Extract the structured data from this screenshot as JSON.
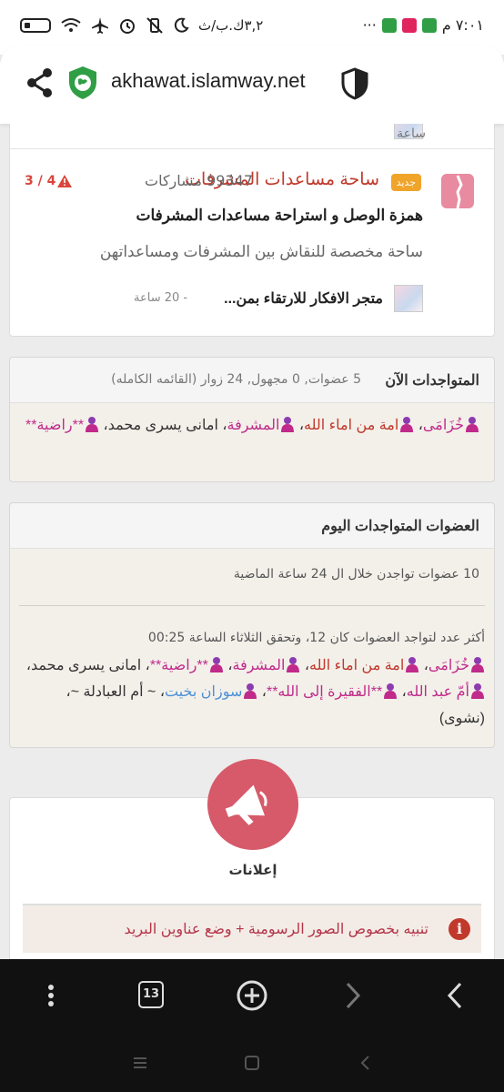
{
  "status_bar": {
    "time": "٧:٠١ م",
    "network_text": "٣,٢ك.ب/ث",
    "overflow": "···"
  },
  "browser": {
    "url": "akhawat.islamway.net",
    "tabs_count": "13"
  },
  "forum": {
    "previous_row_text": "ساعة",
    "new_badge": "جديد",
    "title": "ساحة مساعدات المشرفات",
    "posts": "99347 مشاركات",
    "warn_count": "3 / 4",
    "subtitle": "همزة الوصل و استراحة مساعدات المشرفات",
    "description": "ساحة مخصصة للنقاش بين المشرفات ومساعداتهن",
    "last_post_title": "متجر الافكار للارتقاء بمن...",
    "last_post_time": "- 20 ساعة"
  },
  "online_now": {
    "title": "المتواجدات الآن",
    "meta": "5 عضوات, 0 مجهول, 24 زوار (القائمه الكامله)",
    "users": [
      {
        "name": "خُزَامَى",
        "color": "#c02a8a"
      },
      {
        "name": "امة من اماء الله",
        "color": "#c0392b"
      },
      {
        "name": "المشرفة",
        "color": "#c02a8a"
      },
      {
        "name": "امانى يسرى محمد",
        "color": "#333333"
      },
      {
        "name": "**راضية**",
        "color": "#c02a8a"
      }
    ]
  },
  "today": {
    "title": "العضوات المتواجدات اليوم",
    "count_line": "10 عضوات تواجدن خلال ال 24 ساعة الماضية",
    "record_line": "أكثر عدد لتواجد العضوات كان 12، وتحقق الثلاثاء الساعة 00:25",
    "users": [
      {
        "name": "خُزَامَى",
        "color": "#c02a8a"
      },
      {
        "name": "امة من اماء الله",
        "color": "#c0392b"
      },
      {
        "name": "المشرفة",
        "color": "#c02a8a"
      },
      {
        "name": "**راضية**",
        "color": "#c02a8a"
      },
      {
        "name": "امانى يسرى محمد",
        "color": "#333333"
      },
      {
        "name": "أمّ عبد الله",
        "color": "#c02a8a"
      },
      {
        "name": "**الفقيرة إلى الله**",
        "color": "#c02a8a"
      },
      {
        "name": "سوزان بخيت",
        "color": "#4a90d9"
      },
      {
        "name": "~ أم العبادلة ~",
        "color": "#333333"
      },
      {
        "name": "(نشوى)",
        "color": "#333333"
      }
    ]
  },
  "announcements": {
    "label": "إعلانات",
    "alert_text": "تنبيه بخصوص الصور الرسومية + وضع عناوين البريد"
  },
  "icons": {
    "share": "share-icon",
    "site": "shield-globe-icon",
    "privacy": "shield-icon",
    "menu": "more-vertical-icon",
    "new_tab": "plus-circle-icon",
    "forward": "chevron-right-icon",
    "back": "chevron-left-icon"
  }
}
